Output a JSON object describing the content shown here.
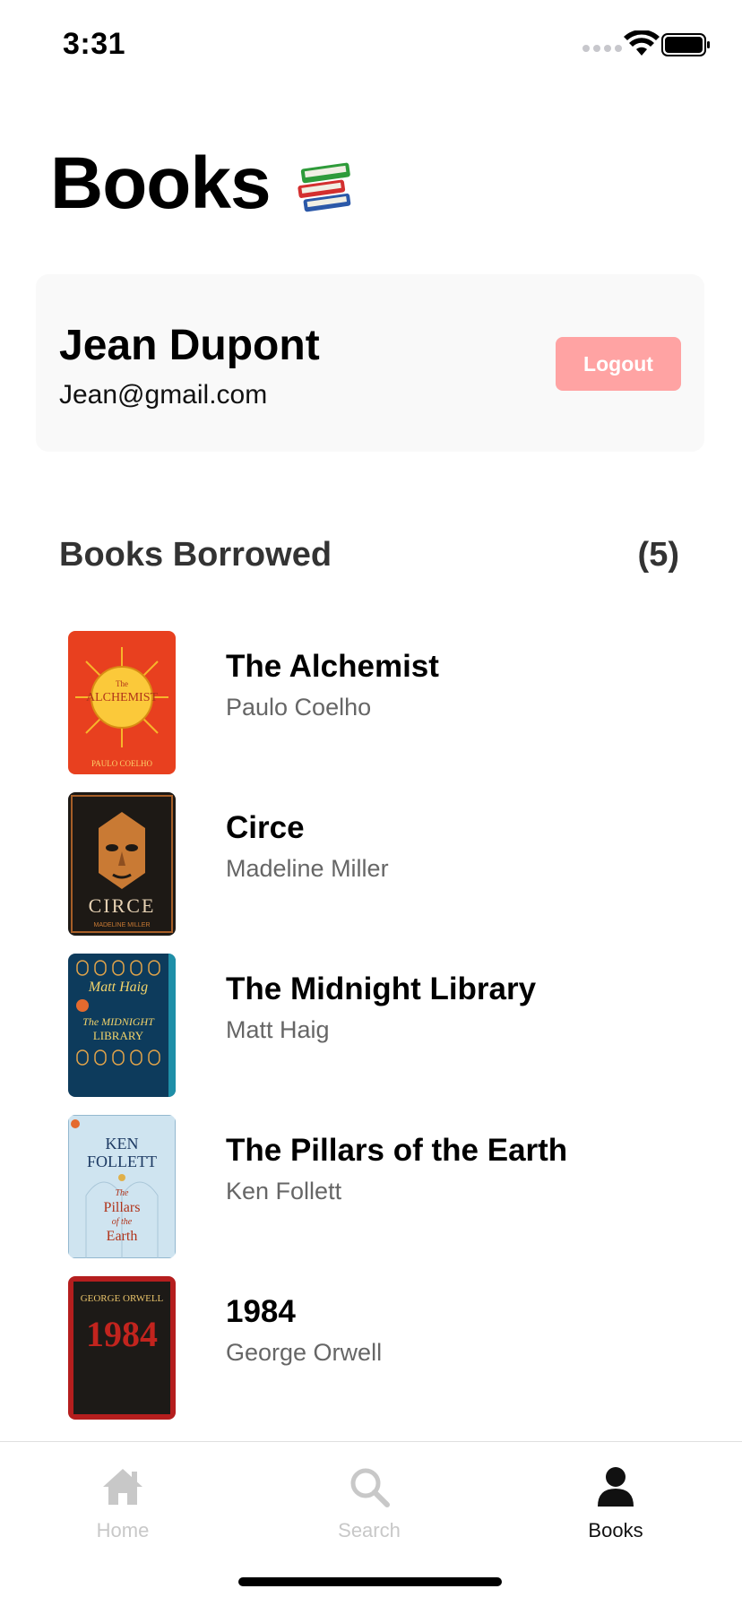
{
  "status_bar": {
    "time": "3:31"
  },
  "header": {
    "title": "Books",
    "icon": "books-stack-icon"
  },
  "user": {
    "name": "Jean Dupont",
    "email": "Jean@gmail.com",
    "logout_label": "Logout"
  },
  "section": {
    "title": "Books Borrowed",
    "count": "(5)"
  },
  "books": [
    {
      "title": "The Alchemist",
      "author": "Paulo Coelho",
      "cover": "the-alchemist-cover"
    },
    {
      "title": "Circe",
      "author": "Madeline Miller",
      "cover": "circe-cover"
    },
    {
      "title": "The Midnight Library",
      "author": "Matt Haig",
      "cover": "the-midnight-library-cover"
    },
    {
      "title": "The Pillars of the Earth",
      "author": "Ken Follett",
      "cover": "the-pillars-of-the-earth-cover"
    },
    {
      "title": "1984",
      "author": "George Orwell",
      "cover": "1984-cover"
    }
  ],
  "tabs": [
    {
      "label": "Home",
      "icon": "home-icon",
      "active": false
    },
    {
      "label": "Search",
      "icon": "search-icon",
      "active": false
    },
    {
      "label": "Books",
      "icon": "person-icon",
      "active": true
    }
  ],
  "colors": {
    "logout_button": "#ffa3a3",
    "card_background": "#f9f9f9",
    "inactive_tab": "#c8c8c8",
    "active_tab": "#111111"
  }
}
